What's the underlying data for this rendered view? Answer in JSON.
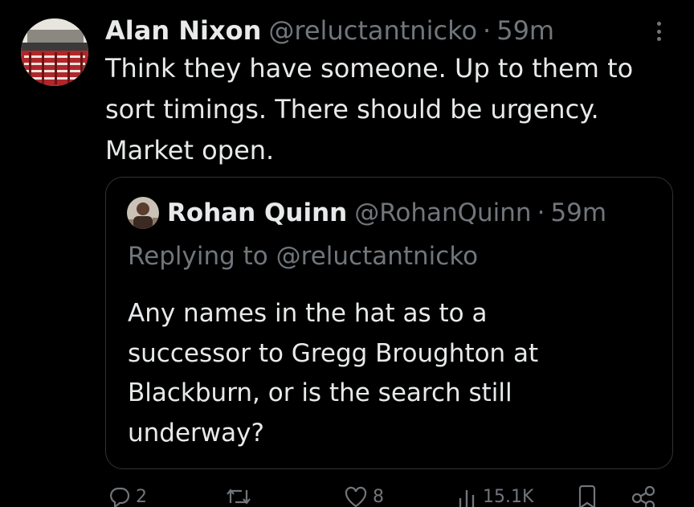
{
  "tweet": {
    "author_name": "Alan Nixon",
    "author_handle": "@reluctantnicko",
    "separator": "·",
    "time": "59m",
    "lines": [
      "Think they have someone. Up to them to",
      "sort timings. There should be urgency.",
      "Market open."
    ]
  },
  "quote": {
    "author_name": "Rohan Quinn",
    "author_handle": "@RohanQuinn",
    "separator": "·",
    "time": "59m",
    "replying_prefix": "Replying to ",
    "replying_handle": "@reluctantnicko",
    "lines": [
      "Any names in the hat as to a",
      "successor to Gregg Broughton at",
      "Blackburn, or is the search still",
      "underway?"
    ]
  },
  "actions": {
    "reply_count": "2",
    "retweet_count": "",
    "like_count": "8",
    "views_count": "15.1K"
  },
  "icons": {
    "more": "more-vertical-icon",
    "reply": "reply-icon",
    "retweet": "retweet-icon",
    "like": "heart-icon",
    "views": "views-chart-icon",
    "bookmark": "bookmark-icon",
    "share": "share-icon"
  },
  "colors": {
    "background": "#000000",
    "text": "#e7e9ea",
    "muted": "#71767b",
    "border": "#2f3336"
  }
}
